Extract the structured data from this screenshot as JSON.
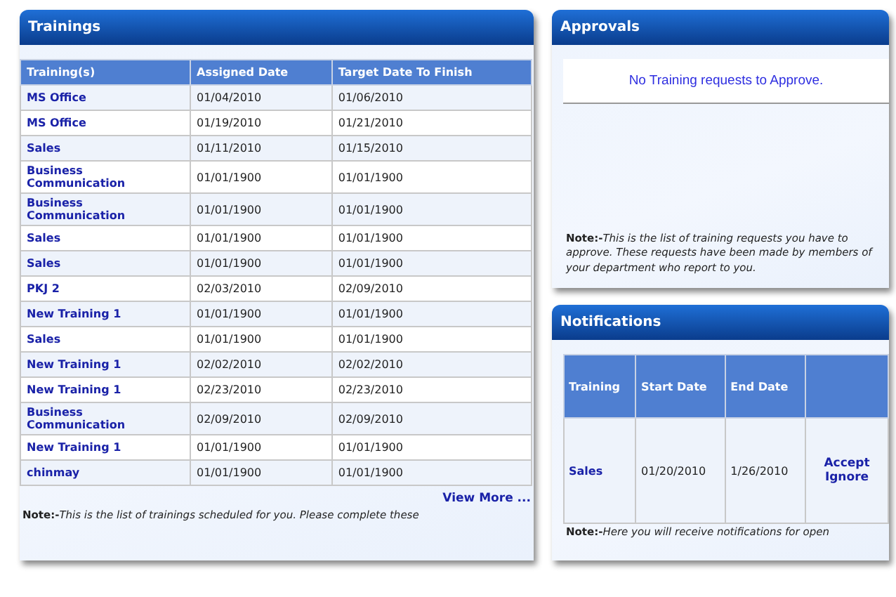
{
  "trainings": {
    "title": "Trainings",
    "columns": [
      "Training(s)",
      "Assigned Date",
      "Target Date To Finish"
    ],
    "rows": [
      {
        "training": "MS Office",
        "assigned": "01/04/2010",
        "target": "01/06/2010"
      },
      {
        "training": "MS Office",
        "assigned": "01/19/2010",
        "target": "01/21/2010"
      },
      {
        "training": "Sales",
        "assigned": "01/11/2010",
        "target": "01/15/2010"
      },
      {
        "training": "Business Communication",
        "assigned": "01/01/1900",
        "target": "01/01/1900"
      },
      {
        "training": "Business Communication",
        "assigned": "01/01/1900",
        "target": "01/01/1900"
      },
      {
        "training": "Sales",
        "assigned": "01/01/1900",
        "target": "01/01/1900"
      },
      {
        "training": "Sales",
        "assigned": "01/01/1900",
        "target": "01/01/1900"
      },
      {
        "training": "PKJ 2",
        "assigned": "02/03/2010",
        "target": "02/09/2010"
      },
      {
        "training": "New Training 1",
        "assigned": "01/01/1900",
        "target": "01/01/1900"
      },
      {
        "training": "Sales",
        "assigned": "01/01/1900",
        "target": "01/01/1900"
      },
      {
        "training": "New Training 1",
        "assigned": "02/02/2010",
        "target": "02/02/2010"
      },
      {
        "training": "New Training 1",
        "assigned": "02/23/2010",
        "target": "02/23/2010"
      },
      {
        "training": "Business Communication",
        "assigned": "02/09/2010",
        "target": "02/09/2010"
      },
      {
        "training": "New Training 1",
        "assigned": "01/01/1900",
        "target": "01/01/1900"
      },
      {
        "training": "chinmay",
        "assigned": "01/01/1900",
        "target": "01/01/1900"
      }
    ],
    "view_more": "View More ...",
    "note": "**Note:-**This is the list of trainings scheduled for you. Please complete these"
  },
  "approvals": {
    "title": "Approvals",
    "empty_message": "No Training requests to Approve.",
    "note": "**Note:-**This is the list of training requests you have to approve. These requests have been made by members of your department who report to you."
  },
  "notifications": {
    "title": "Notifications",
    "columns": [
      "Training",
      "Start Date",
      "End Date"
    ],
    "rows": [
      {
        "training": "Sales",
        "start": "01/20/2010",
        "end": "1/26/2010",
        "actions": [
          "Accept",
          "Ignore"
        ]
      }
    ],
    "note": "**Note:-**Here you will receive notifications for open"
  }
}
